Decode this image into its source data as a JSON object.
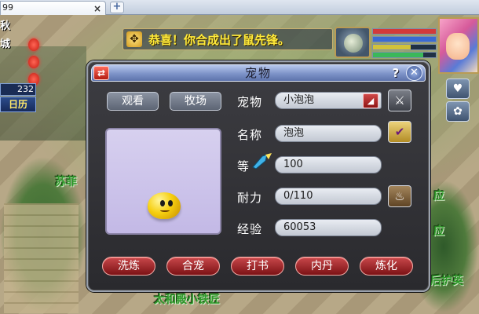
{
  "browser": {
    "tab_title": "99",
    "tab_close": "×",
    "new_tab": "+"
  },
  "hud": {
    "city_line1": "秋",
    "city_line2": "城",
    "coord": "232",
    "calendar": "日历"
  },
  "banner": {
    "icon": "✥",
    "message": "恭喜！你合成出了鼠先锋。"
  },
  "scene_labels": {
    "npc1": "苏菲",
    "npc2": "太和殿小铁匠",
    "npc3": "应",
    "npc4": "应",
    "npc5": "后护英"
  },
  "stats_bars": [
    {
      "name": "hp",
      "color": "#d23a3a",
      "fill": 1.0
    },
    {
      "name": "mp",
      "color": "#3a6ad2",
      "fill": 1.0
    },
    {
      "name": "exp",
      "color": "#d2c23a",
      "fill": 0.6
    },
    {
      "name": "loyalty",
      "color": "#3ab85a",
      "fill": 0.8
    }
  ],
  "side_buttons": [
    "heart-icon",
    "orb-icon"
  ],
  "dialog": {
    "title": "宠物",
    "swap_icon": "⇄",
    "help": "?",
    "close": "✕",
    "tabs": {
      "view": "观看",
      "ranch": "牧场"
    },
    "fields": {
      "pet_label": "宠物",
      "pet_value": "小泡泡",
      "name_label": "名称",
      "name_value": "泡泡",
      "level_label": "等",
      "level_value": "100",
      "stamina_label": "耐力",
      "stamina_value": "0/110",
      "exp_label": "经验",
      "exp_value": "60053"
    },
    "buttons": {
      "wash": "洗炼",
      "merge": "合宠",
      "book": "打书",
      "core": "内丹",
      "refine": "炼化"
    }
  }
}
